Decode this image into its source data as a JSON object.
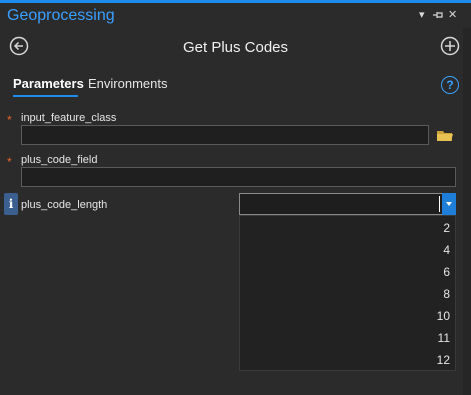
{
  "pane": {
    "title": "Geoprocessing",
    "icons": [
      "chevron-down-icon",
      "pin-icon",
      "close-icon"
    ],
    "accent_color": "#1f8ceb"
  },
  "tool": {
    "title": "Get Plus Codes",
    "back_icon": "back-arrow-icon",
    "add_icon": "add-icon"
  },
  "tabs": [
    {
      "label": "Parameters",
      "active": true
    },
    {
      "label": "Environments",
      "active": false
    }
  ],
  "help_icon": "help-icon",
  "parameters": {
    "input_feature_class": {
      "label": "input_feature_class",
      "required": true,
      "value": "",
      "browse_icon": "folder-icon"
    },
    "plus_code_field": {
      "label": "plus_code_field",
      "required": true,
      "value": ""
    },
    "plus_code_length": {
      "label": "plus_code_length",
      "required": false,
      "value": "",
      "info_icon": "info-icon",
      "options": [
        "2",
        "4",
        "6",
        "8",
        "10",
        "11",
        "12"
      ],
      "dropdown_open": true
    }
  },
  "required_marker": "*",
  "colors": {
    "required": "#e8632c",
    "link": "#3aa0ff",
    "background": "#2b2b2b"
  }
}
